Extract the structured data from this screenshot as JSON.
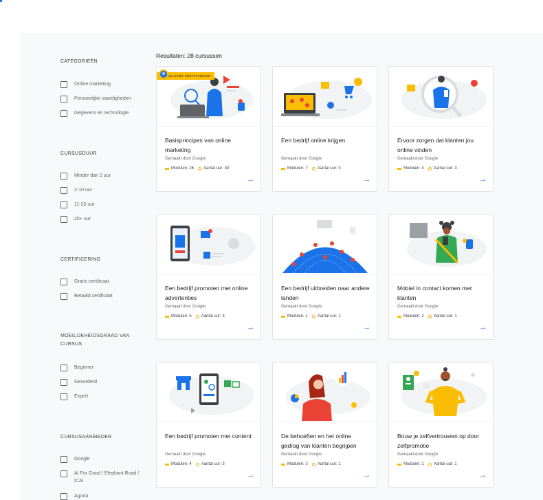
{
  "sidebar": {
    "sections": [
      {
        "title": "CATEGORIEËN",
        "options": [
          "Online marketing",
          "Persoonlijke vaardigheden",
          "Gegevens en technologie"
        ]
      },
      {
        "title": "CURSUSDUUR",
        "options": [
          "Minder dan 2 uur",
          "2-10 uur",
          "11-20 uur",
          "20+ uur"
        ]
      },
      {
        "title": "CERTIFICERING",
        "options": [
          "Gratis certificaat",
          "Betaald certificaat"
        ]
      },
      {
        "title": "MOEILIJKHEIDSGRAAD VAN CURSUS",
        "options": [
          "Beginner",
          "Gevorderd",
          "Expert"
        ]
      },
      {
        "title": "CURSUSAANBIEDER",
        "options": [
          "Google",
          "AI For Good / Elephant Road / ICAI",
          "Agoria"
        ]
      }
    ]
  },
  "results_label": "Resultaten: 28 cursussen",
  "badge_label": "Inclusief certificering",
  "cards": [
    {
      "title": "Basisprincipes van online marketing",
      "by": "Gemaakt door Google",
      "modules": "Modulen: 26",
      "hours": "Aantal uur: 40",
      "icon": "laptop-person-illustration"
    },
    {
      "title": "Een bedrijf online krijgen",
      "by": "Gemaakt door Google",
      "modules": "Modulen: 7",
      "hours": "Aantal uur: 3",
      "icon": "laptop-shop-illustration"
    },
    {
      "title": "Ervoor zorgen dat klanten jou online vinden",
      "by": "Gemaakt door Google",
      "modules": "Modulen: 4",
      "hours": "Aantal uur: 3",
      "icon": "magnifier-person-illustration"
    },
    {
      "title": "Een bedrijf promoten met online advertenties",
      "by": "Gemaakt door Google",
      "modules": "Modulen: 5",
      "hours": "Aantal uur: 3",
      "icon": "phone-ads-illustration"
    },
    {
      "title": "Een bedrijf uitbreiden naar andere landen",
      "by": "Gemaakt door Google",
      "modules": "Modulen: 1",
      "hours": "Aantal uur: 1",
      "icon": "globe-pins-illustration"
    },
    {
      "title": "Mobiel in contact komen met klanten",
      "by": "Gemaakt door Google",
      "modules": "Modulen: 2",
      "hours": "Aantal uur: 1",
      "icon": "woman-phone-illustration"
    },
    {
      "title": "Een bedrijf promoten met content",
      "by": "Gemaakt door Google",
      "modules": "Modulen: 4",
      "hours": "Aantal uur: 3",
      "icon": "store-phone-illustration"
    },
    {
      "title": "De behoeften en het online gedrag van klanten begrijpen",
      "by": "Gemaakt door Google",
      "modules": "Modulen: 3",
      "hours": "Aantal uur: 1",
      "icon": "woman-thinking-illustration"
    },
    {
      "title": "Bouw je zelfvertrouwen op door zelfpromotie",
      "by": "Gemaakt door Google",
      "modules": "Modulen: 1",
      "hours": "Aantal uur: 1",
      "icon": "confident-man-illustration"
    }
  ],
  "colors": {
    "accent": "#1a73e8",
    "yellow": "#fbbc04",
    "red": "#ea4335",
    "green": "#34a853",
    "panel": "#f8f9fa"
  }
}
